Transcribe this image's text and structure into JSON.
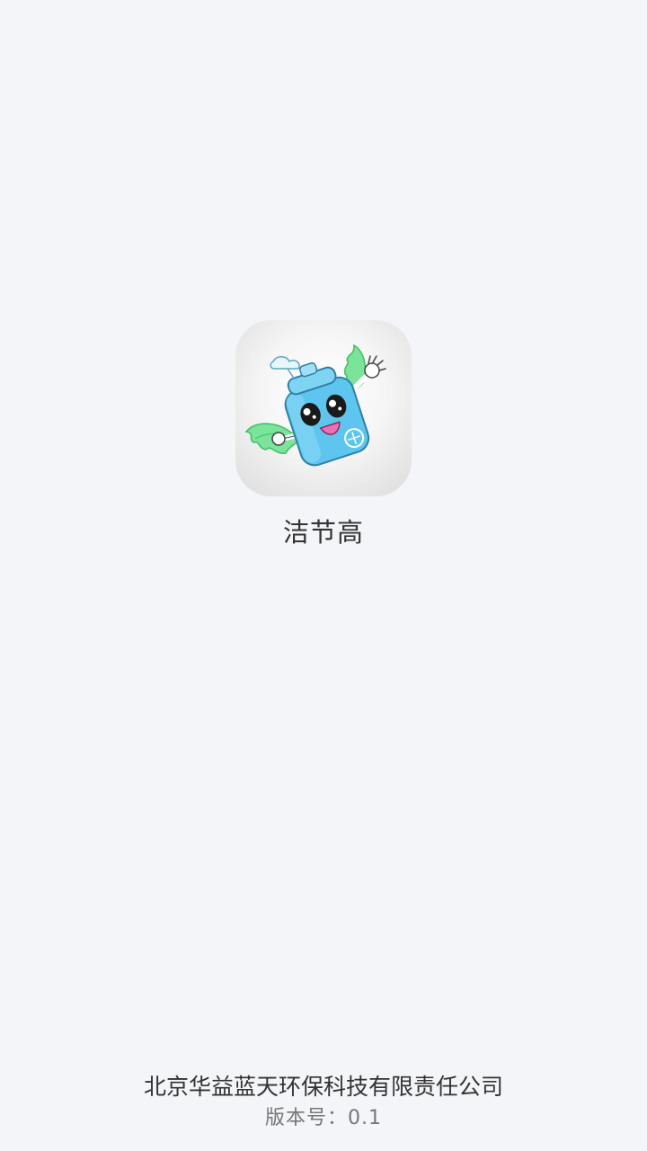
{
  "splash": {
    "app_name": "洁节高",
    "company": "北京华益蓝天环保科技有限责任公司",
    "version": "版本号：0.1",
    "icon": "mascot-app-icon"
  },
  "colors": {
    "background": "#f4f5f9",
    "text_primary": "#333333",
    "text_secondary": "#777777",
    "mascot_blue": "#5ec6ee",
    "wing_green": "#6fdc8c"
  }
}
